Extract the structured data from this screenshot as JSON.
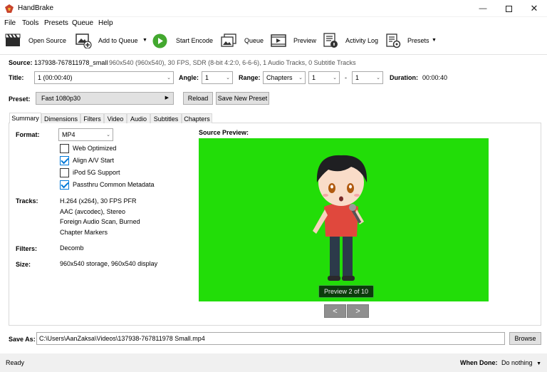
{
  "window": {
    "title": "HandBrake"
  },
  "menu": {
    "file": "File",
    "tools": "Tools",
    "presets": "Presets",
    "queue": "Queue",
    "help": "Help"
  },
  "toolbar": {
    "open_source": "Open Source",
    "add_to_queue": "Add to Queue",
    "start_encode": "Start Encode",
    "queue": "Queue",
    "preview": "Preview",
    "activity_log": "Activity Log",
    "presets": "Presets"
  },
  "source": {
    "label": "Source:",
    "name": "137938-767811978_small",
    "details": "960x540 (960x540), 30 FPS, SDR (8-bit 4:2:0, 6-6-6), 1 Audio Tracks, 0 Subtitle Tracks"
  },
  "title_row": {
    "title_label": "Title:",
    "title_value": "1  (00:00:40)",
    "angle_label": "Angle:",
    "angle_value": "1",
    "range_label": "Range:",
    "range_value": "Chapters",
    "range_from": "1",
    "range_dash": "-",
    "range_to": "1",
    "duration_label": "Duration:",
    "duration_value": "00:00:40"
  },
  "preset_row": {
    "label": "Preset:",
    "value": "Fast 1080p30",
    "reload": "Reload",
    "save_new": "Save New Preset"
  },
  "tabs": [
    "Summary",
    "Dimensions",
    "Filters",
    "Video",
    "Audio",
    "Subtitles",
    "Chapters"
  ],
  "summary": {
    "format_label": "Format:",
    "format_value": "MP4",
    "options": [
      {
        "label": "Web Optimized",
        "checked": false
      },
      {
        "label": "Align A/V Start",
        "checked": true
      },
      {
        "label": "iPod 5G Support",
        "checked": false
      },
      {
        "label": "Passthru Common Metadata",
        "checked": true
      }
    ],
    "tracks_label": "Tracks:",
    "tracks": [
      "H.264 (x264), 30 FPS PFR",
      "AAC (avcodec), Stereo",
      "Foreign Audio Scan, Burned",
      "Chapter Markers"
    ],
    "filters_label": "Filters:",
    "filters_value": "Decomb",
    "size_label": "Size:",
    "size_value": "960x540 storage, 960x540 display"
  },
  "preview": {
    "label": "Source Preview:",
    "badge": "Preview 2 of 10",
    "prev": "<",
    "next": ">"
  },
  "save_as": {
    "label": "Save As:",
    "path": "C:\\Users\\AanZaksa\\Videos\\137938-767811978 Small.mp4",
    "browse": "Browse"
  },
  "status": {
    "text": "Ready",
    "when_done_label": "When Done:",
    "when_done_value": "Do nothing"
  }
}
